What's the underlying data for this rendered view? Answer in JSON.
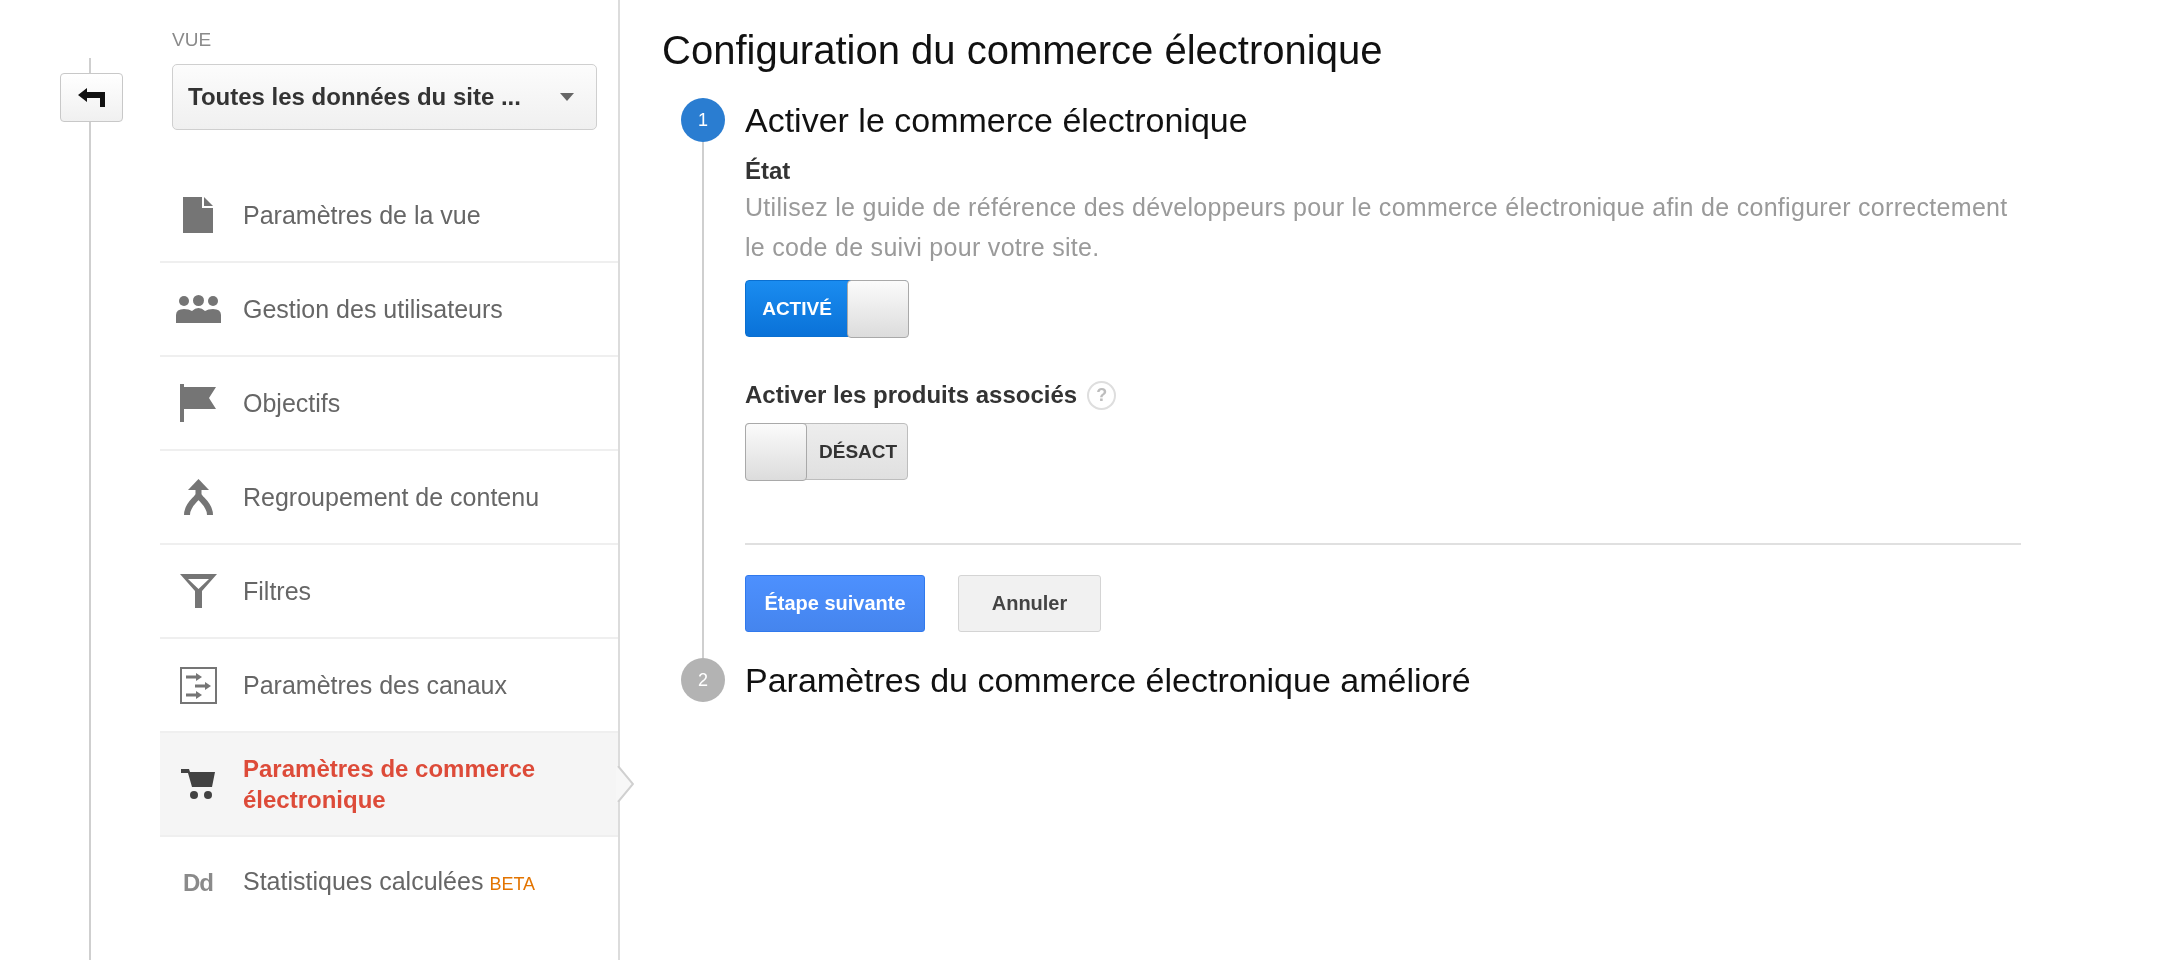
{
  "view_selector": {
    "label": "VUE",
    "value": "Toutes les données du site ..."
  },
  "sidebar": {
    "items": [
      {
        "label": "Paramètres de la vue",
        "selected": false
      },
      {
        "label": "Gestion des utilisateurs",
        "selected": false
      },
      {
        "label": "Objectifs",
        "selected": false
      },
      {
        "label": "Regroupement de contenu",
        "selected": false
      },
      {
        "label": "Filtres",
        "selected": false
      },
      {
        "label": "Paramètres des canaux",
        "selected": false
      },
      {
        "label": "Paramètres de commerce électronique",
        "selected": true
      },
      {
        "label": "Statistiques calculées",
        "icon_text": "Dd",
        "badge": "BETA",
        "selected": false
      }
    ]
  },
  "page": {
    "title": "Configuration du commerce électronique"
  },
  "steps": [
    {
      "number": "1",
      "title": "Activer le commerce électronique",
      "active": true,
      "fields": [
        {
          "label": "État",
          "description": "Utilisez le guide de référence des développeurs pour le commerce électronique afin de configurer correctement le code de suivi pour votre site.",
          "toggle": {
            "on": true,
            "text": "ACTIVÉ"
          }
        },
        {
          "label": "Activer les produits associés",
          "help": "?",
          "toggle": {
            "on": false,
            "text": "DÉSACT"
          }
        }
      ],
      "buttons": [
        {
          "label": "Étape suivante",
          "kind": "primary"
        },
        {
          "label": "Annuler",
          "kind": "secondary"
        }
      ]
    },
    {
      "number": "2",
      "title": "Paramètres du commerce électronique amélioré",
      "active": false
    }
  ]
}
